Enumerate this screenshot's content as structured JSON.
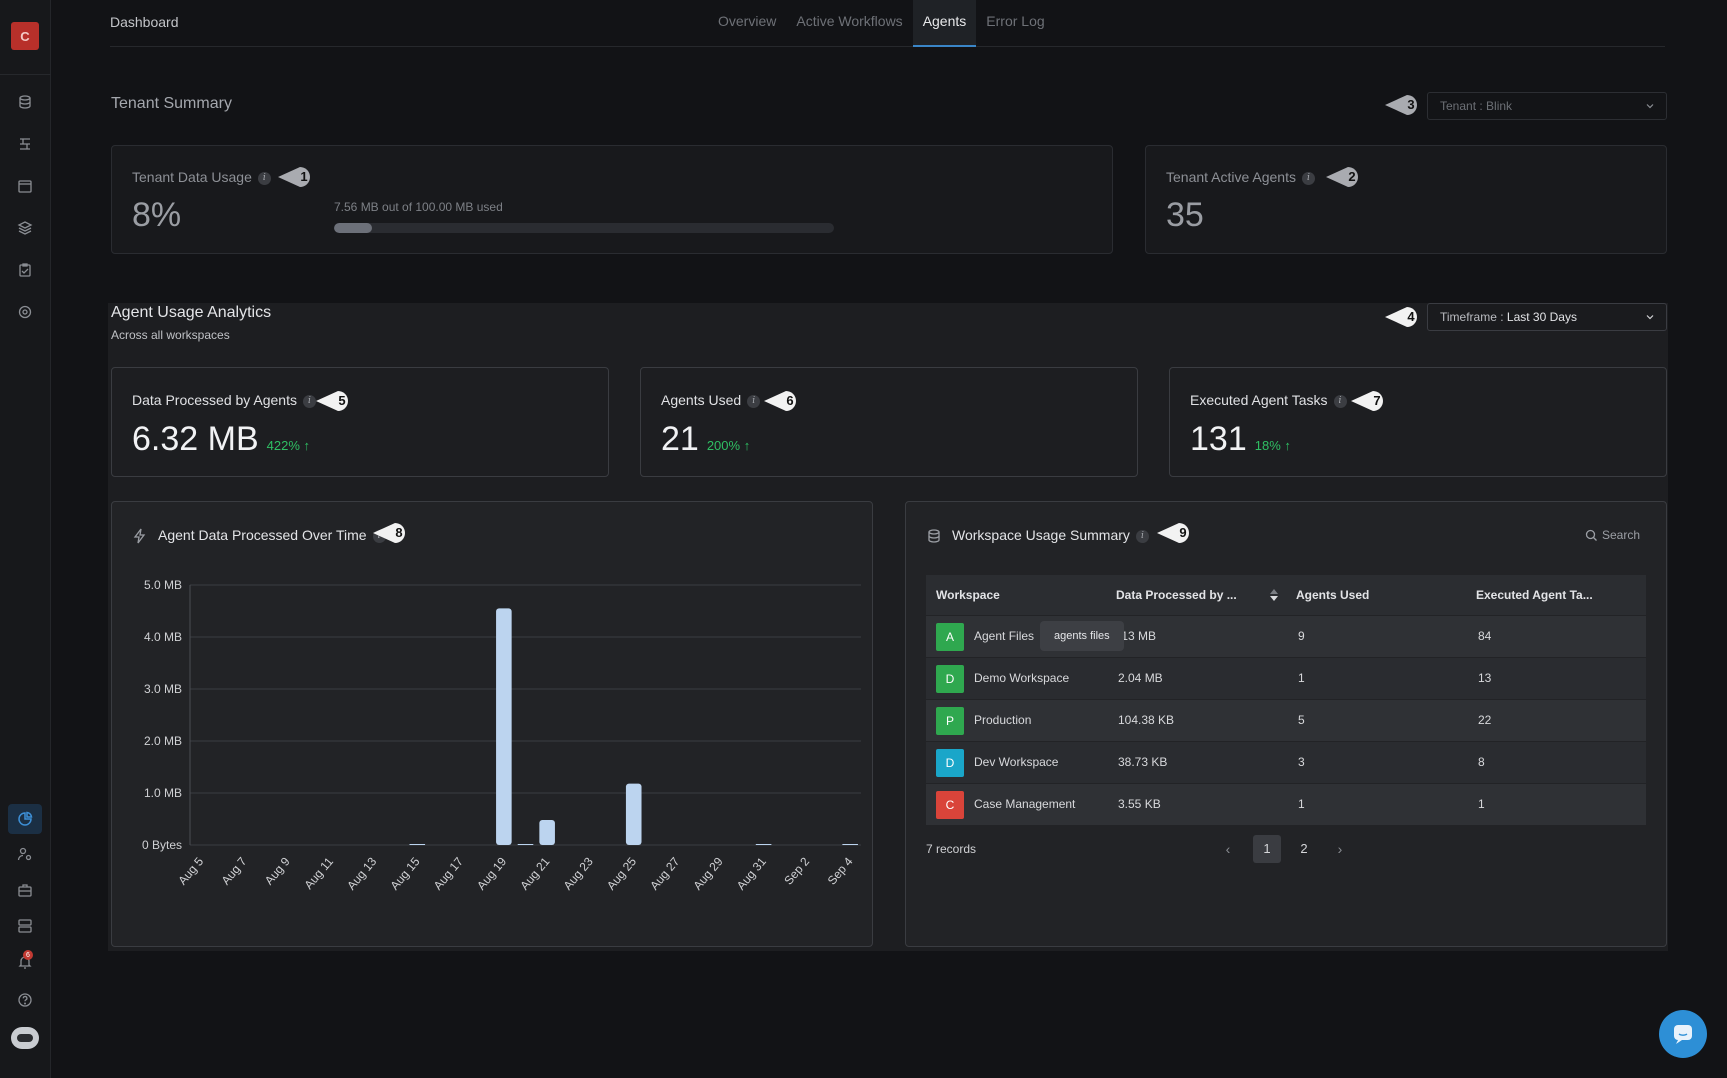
{
  "app": {
    "logo_letter": "C"
  },
  "header": {
    "breadcrumb": "Dashboard",
    "tabs": [
      {
        "label": "Overview"
      },
      {
        "label": "Active Workflows"
      },
      {
        "label": "Agents"
      },
      {
        "label": "Error Log"
      }
    ]
  },
  "tenant_summary": {
    "title": "Tenant Summary",
    "tenant_dropdown": {
      "label": "Tenant : ",
      "value": "Blink"
    },
    "data_usage": {
      "label": "Tenant Data Usage",
      "value": "8%",
      "detail": "7.56 MB out of 100.00 MB used",
      "fraction": 0.0756
    },
    "active_agents": {
      "label": "Tenant Active Agents",
      "value": "35"
    }
  },
  "analytics": {
    "title": "Agent Usage Analytics",
    "subtitle": "Across all workspaces",
    "timeframe_dropdown": {
      "label": "Timeframe : ",
      "value": "Last 30 Days"
    },
    "kpis": [
      {
        "label": "Data Processed by Agents",
        "value": "6.32 MB",
        "change": "422%"
      },
      {
        "label": "Agents Used",
        "value": "21",
        "change": "200%"
      },
      {
        "label": "Executed Agent Tasks",
        "value": "131",
        "change": "18%"
      }
    ]
  },
  "chart_panel": {
    "title": "Agent Data Processed Over Time"
  },
  "chart_data": {
    "type": "bar",
    "title": "Agent Data Processed Over Time",
    "xlabel": "",
    "ylabel": "",
    "y_ticks": [
      "0 Bytes",
      "1.0 MB",
      "2.0 MB",
      "3.0 MB",
      "4.0 MB",
      "5.0 MB"
    ],
    "ylim": [
      0,
      5
    ],
    "x_tick_labels": [
      "Aug 5",
      "Aug 7",
      "Aug 9",
      "Aug 11",
      "Aug 13",
      "Aug 15",
      "Aug 17",
      "Aug 19",
      "Aug 21",
      "Aug 23",
      "Aug 25",
      "Aug 27",
      "Aug 29",
      "Aug 31",
      "Sep 2",
      "Sep 4"
    ],
    "categories": [
      "Aug 5",
      "Aug 6",
      "Aug 7",
      "Aug 8",
      "Aug 9",
      "Aug 10",
      "Aug 11",
      "Aug 12",
      "Aug 13",
      "Aug 14",
      "Aug 15",
      "Aug 16",
      "Aug 17",
      "Aug 18",
      "Aug 19",
      "Aug 20",
      "Aug 21",
      "Aug 22",
      "Aug 23",
      "Aug 24",
      "Aug 25",
      "Aug 26",
      "Aug 27",
      "Aug 28",
      "Aug 29",
      "Aug 30",
      "Aug 31",
      "Sep 1",
      "Sep 2",
      "Sep 3",
      "Sep 4"
    ],
    "values": [
      0,
      0,
      0,
      0,
      0,
      0,
      0,
      0,
      0,
      0,
      0.01,
      0,
      0,
      0,
      4.55,
      0.01,
      0.48,
      0,
      0,
      0,
      1.18,
      0,
      0,
      0,
      0,
      0,
      0.01,
      0,
      0,
      0,
      0.01
    ],
    "bar_color": "#bcd4ef",
    "grid": true
  },
  "workspace_panel": {
    "title": "Workspace Usage Summary",
    "search_label": "Search",
    "columns": [
      "Workspace",
      "Data Processed by ...",
      "Agents Used",
      "Executed Agent Ta..."
    ],
    "rows": [
      {
        "letter": "A",
        "color": "#2fa84f",
        "workspace": "Agent Files",
        "data": ".13 MB",
        "agents": "9",
        "tasks": "84"
      },
      {
        "letter": "D",
        "color": "#2fa84f",
        "workspace": "Demo Workspace",
        "data": "2.04 MB",
        "agents": "1",
        "tasks": "13"
      },
      {
        "letter": "P",
        "color": "#2fa84f",
        "workspace": "Production",
        "data": "104.38 KB",
        "agents": "5",
        "tasks": "22"
      },
      {
        "letter": "D",
        "color": "#1aa6c9",
        "workspace": "Dev Workspace",
        "data": "38.73 KB",
        "agents": "3",
        "tasks": "8"
      },
      {
        "letter": "C",
        "color": "#d9443a",
        "workspace": "Case Management",
        "data": "3.55 KB",
        "agents": "1",
        "tasks": "1"
      }
    ],
    "tooltip": "agents files",
    "records": "7 records",
    "pages": [
      "1",
      "2"
    ],
    "current_page": "1"
  },
  "markers": [
    "1",
    "2",
    "3",
    "4",
    "5",
    "6",
    "7",
    "8",
    "9"
  ],
  "sidebar_badge": "6"
}
